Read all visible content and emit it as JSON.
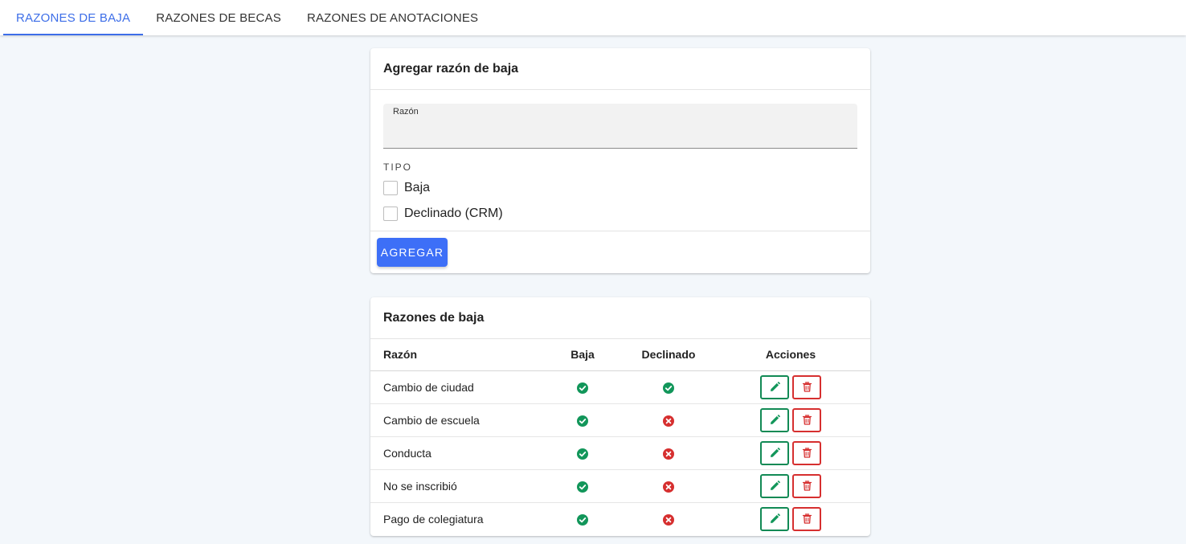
{
  "tabs": [
    {
      "label": "RAZONES DE BAJA",
      "active": true
    },
    {
      "label": "RAZONES DE BECAS",
      "active": false
    },
    {
      "label": "RAZONES DE ANOTACIONES",
      "active": false
    }
  ],
  "add_form": {
    "title": "Agregar razón de baja",
    "field_label": "Razón",
    "field_value": "",
    "tipo_label": "TIPO",
    "options": [
      {
        "label": "Baja",
        "checked": false
      },
      {
        "label": "Declinado (CRM)",
        "checked": false
      }
    ],
    "submit_label": "AGREGAR"
  },
  "list": {
    "title": "Razones de baja",
    "columns": [
      "Razón",
      "Baja",
      "Declinado",
      "Acciones"
    ],
    "rows": [
      {
        "razon": "Cambio de ciudad",
        "baja": "yes",
        "declinado": "yes"
      },
      {
        "razon": "Cambio de escuela",
        "baja": "yes",
        "declinado": "no"
      },
      {
        "razon": "Conducta",
        "baja": "yes",
        "declinado": "no"
      },
      {
        "razon": "No se inscribió",
        "baja": "yes",
        "declinado": "no"
      },
      {
        "razon": "Pago de colegiatura",
        "baja": "yes",
        "declinado": "no"
      }
    ]
  },
  "colors": {
    "accent": "#3d6ee8",
    "button": "#3d6ff7",
    "success": "#12965a",
    "danger": "#d62f2f"
  },
  "icons": {
    "yes": "check-circle-icon",
    "no": "x-circle-icon",
    "edit": "pencil-icon",
    "delete": "trash-icon"
  }
}
